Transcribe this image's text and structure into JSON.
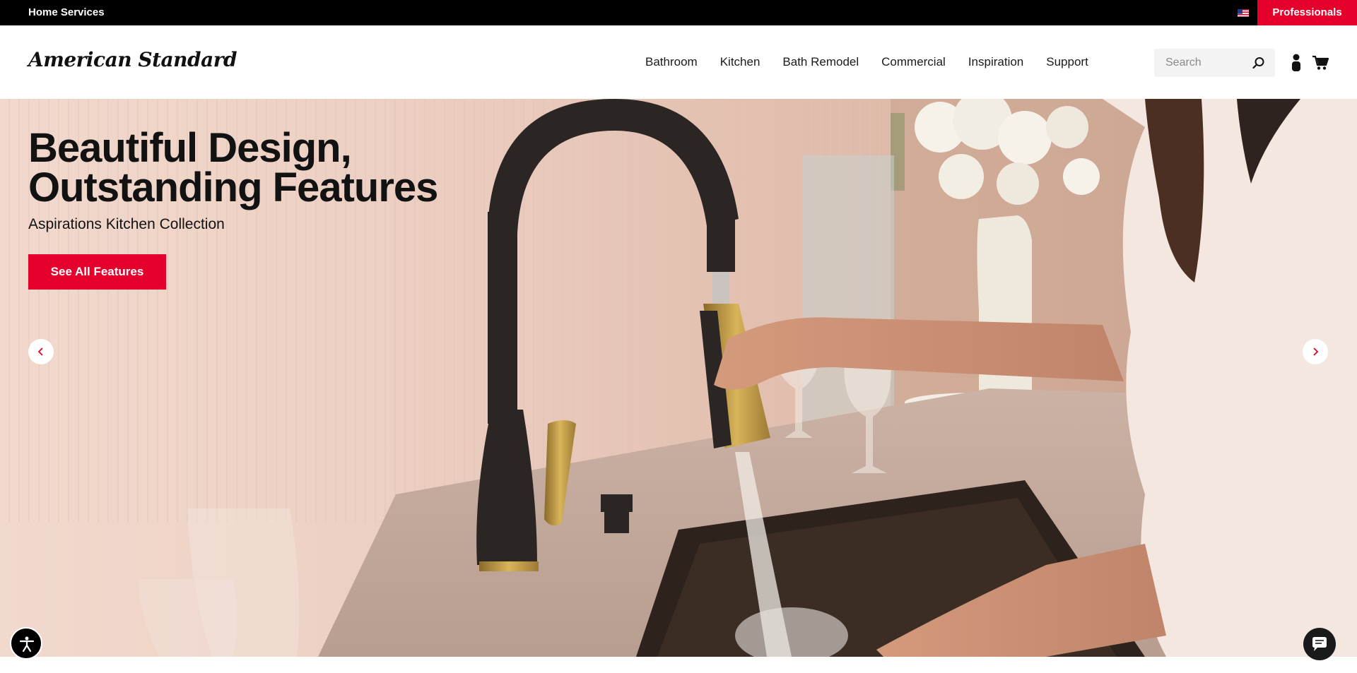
{
  "topbar": {
    "home_services": "Home Services",
    "flag_icon": "us-flag-icon",
    "professionals": "Professionals"
  },
  "header": {
    "logo": "American Standard",
    "nav": [
      "Bathroom",
      "Kitchen",
      "Bath Remodel",
      "Commercial",
      "Inspiration",
      "Support"
    ],
    "search_placeholder": "Search",
    "icons": [
      "search-icon",
      "account-icon",
      "cart-icon"
    ]
  },
  "hero": {
    "title_line1": "Beautiful Design,",
    "title_line2": "Outstanding Features",
    "subtitle": "Aspirations Kitchen Collection",
    "cta": "See All Features",
    "prev_icon": "chevron-left-icon",
    "next_icon": "chevron-right-icon"
  },
  "widgets": {
    "accessibility_icon": "accessibility-icon",
    "chat_icon": "chat-icon"
  },
  "colors": {
    "brand_red": "#e4002b",
    "topbar": "#000000",
    "text": "#121212"
  }
}
